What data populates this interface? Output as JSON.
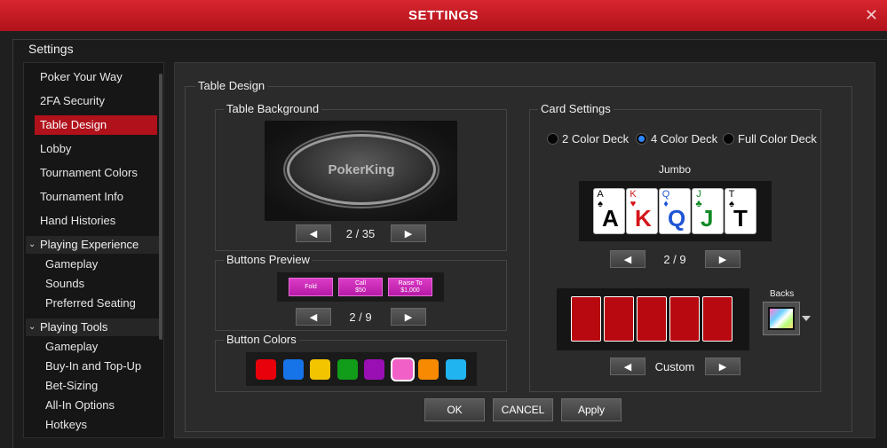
{
  "window": {
    "title": "SETTINGS",
    "close_icon": "✕"
  },
  "panel_label": "Settings",
  "sidebar": {
    "items": [
      {
        "label": "Poker Your Way"
      },
      {
        "label": "2FA Security"
      },
      {
        "label": "Table Design",
        "active": true
      },
      {
        "label": "Lobby"
      },
      {
        "label": "Tournament Colors"
      },
      {
        "label": "Tournament Info"
      },
      {
        "label": "Hand Histories"
      }
    ],
    "groups": [
      {
        "label": "Playing Experience",
        "children": [
          "Gameplay",
          "Sounds",
          "Preferred Seating"
        ]
      },
      {
        "label": "Playing Tools",
        "children": [
          "Gameplay",
          "Buy-In and Top-Up",
          "Bet-Sizing",
          "All-In Options",
          "Hotkeys"
        ]
      }
    ]
  },
  "table_design": {
    "legend": "Table Design",
    "table_background": {
      "legend": "Table Background",
      "logo": "PokerKing",
      "pager": "2 / 35"
    },
    "buttons_preview": {
      "legend": "Buttons Preview",
      "fold": "Fold",
      "call_line1": "Call",
      "call_line2": "$50",
      "raise_line1": "Raise To",
      "raise_line2": "$1,000",
      "pager": "2 / 9"
    },
    "button_colors": {
      "legend": "Button Colors",
      "swatches": [
        "#e8000b",
        "#1673e8",
        "#f2c400",
        "#119c19",
        "#9a0fb4",
        "#f060c7",
        "#f78a00",
        "#20b4f0"
      ],
      "selected_index": 5
    },
    "card_settings": {
      "legend": "Card Settings",
      "options": [
        {
          "label": "2 Color Deck",
          "selected": false
        },
        {
          "label": "4 Color Deck",
          "selected": true
        },
        {
          "label": "Full Color Deck",
          "selected": false
        }
      ],
      "deck_style": "Jumbo",
      "cards": [
        {
          "rank": "A",
          "suit": "♠",
          "color": "#000000"
        },
        {
          "rank": "K",
          "suit": "♥",
          "color": "#d4141a"
        },
        {
          "rank": "Q",
          "suit": "♦",
          "color": "#1f55d6"
        },
        {
          "rank": "J",
          "suit": "♣",
          "color": "#108a24"
        },
        {
          "rank": "T",
          "suit": "♠",
          "color": "#000000"
        }
      ],
      "deck_pager": "2 / 9",
      "back_pager": "Custom",
      "backs_label": "Backs"
    }
  },
  "actions": {
    "ok": "OK",
    "cancel": "CANCEL",
    "apply": "Apply"
  },
  "icons": {
    "prev": "◀",
    "next": "▶",
    "chevron": "⌄"
  }
}
